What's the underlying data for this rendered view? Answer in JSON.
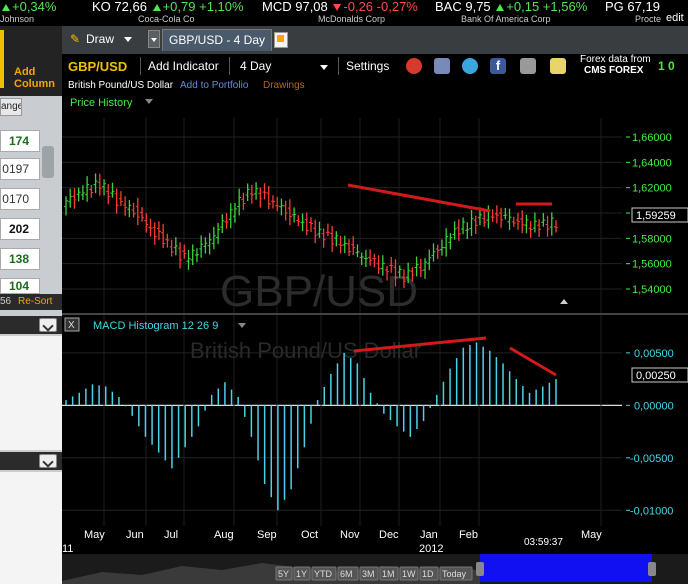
{
  "ticker": [
    {
      "symbol": "",
      "price": "",
      "change": "+0,34%",
      "direction": "up",
      "name": "Johnson"
    },
    {
      "symbol": "KO",
      "price": "72,66",
      "change": "+0,79",
      "pct": "+1,10%",
      "direction": "up",
      "name": "Coca-Cola Co"
    },
    {
      "symbol": "MCD",
      "price": "97,08",
      "change": "-0,26",
      "pct": "-0,27%",
      "direction": "down",
      "name": "McDonalds Corp"
    },
    {
      "symbol": "BAC",
      "price": "9,75",
      "change": "+0,15",
      "pct": "+1,56%",
      "direction": "up",
      "name": "Bank Of America Corp"
    },
    {
      "symbol": "PG",
      "price": "67,19",
      "change": "",
      "pct": "",
      "direction": "up",
      "name": "Procte"
    }
  ],
  "edit_label": "edit",
  "left_panel": {
    "add_column": [
      "Add",
      "Column"
    ],
    "change_header": "ange",
    "cells": [
      "174",
      "0197",
      "0170",
      "202",
      "138",
      "104"
    ],
    "small_left": "56",
    "resort": "Re-Sort"
  },
  "toolbar": {
    "draw_label": "Draw",
    "tab_label": "GBP/USD - 4 Day"
  },
  "chart_toolbar": {
    "symbol": "GBP/USD",
    "add_indicator": "Add Indicator",
    "period": "4 Day",
    "settings": "Settings",
    "forex_line1": "Forex data from",
    "forex_line2": "CMS FOREX",
    "right_label": "1 0"
  },
  "chart_header": {
    "description": "British Pound/US Dollar",
    "add_portfolio": "Add to Portfolio",
    "drawings": "Drawings",
    "price_history": "Price History"
  },
  "watermark": {
    "line1": "GBP/USD",
    "line2": "British Pound/US Dollar"
  },
  "macd": {
    "label": "MACD Histogram 12 26 9",
    "close_label": "X",
    "current": "0,00250"
  },
  "price_current": "1,59259",
  "clock": "03:59:37",
  "range_buttons": [
    "5Y",
    "1Y",
    "YTD",
    "6M",
    "3M",
    "1M",
    "1W",
    "1D",
    "Today"
  ],
  "colors": {
    "up_bar": "#38d438",
    "down_bar": "#ff3a3a",
    "macd_bar": "#4ad3e6",
    "trend_line": "#d21a1a",
    "axis_green": "#3ef03e",
    "axis_cyan": "#3fd8e8"
  },
  "chart_data": [
    {
      "type": "bar",
      "subtype": "ohlc",
      "series": [
        {
          "name": "Price History",
          "values": [
            1.608,
            1.617,
            1.623,
            1.61,
            1.602,
            1.588,
            1.576,
            1.564,
            1.572,
            1.586,
            1.605,
            1.618,
            1.611,
            1.602,
            1.592,
            1.584,
            1.578,
            1.57,
            1.562,
            1.556,
            1.55,
            1.558,
            1.572,
            1.586,
            1.592,
            1.598,
            1.596,
            1.591,
            1.59,
            1.5926
          ]
        }
      ],
      "y_axis": {
        "ticks": [
          1.54,
          1.56,
          1.58,
          1.6,
          1.62,
          1.64,
          1.66
        ],
        "tick_labels": [
          "1,54000",
          "1,56000",
          "1,58000",
          "1,60000",
          "1,62000",
          "1,64000",
          "1,66000"
        ],
        "ylim": [
          1.525,
          1.675
        ]
      },
      "x_axis": {
        "tick_labels": [
          "Jun",
          "Jul",
          "Aug",
          "Sep",
          "Oct",
          "Nov",
          "Dec",
          "Jan",
          "Feb",
          "May"
        ],
        "year_label": "2012",
        "left_label": "11"
      },
      "grid": true
    },
    {
      "type": "bar",
      "title": "MACD Histogram 12 26 9",
      "series": [
        {
          "name": "MACD Histogram 12 26 9",
          "values": [
            0.0005,
            0.0012,
            0.002,
            0.0018,
            0.0008,
            -0.001,
            -0.003,
            -0.0045,
            -0.006,
            -0.004,
            -0.002,
            0.001,
            0.0022,
            0.0008,
            -0.003,
            -0.0075,
            -0.01,
            -0.008,
            -0.004,
            0.0005,
            0.003,
            0.005,
            0.004,
            0.0012,
            -0.0008,
            -0.002,
            -0.003,
            -0.0015,
            0.001,
            0.0035,
            0.0055,
            0.006,
            0.0052,
            0.004,
            0.0025,
            0.0012,
            0.0018,
            0.0025
          ]
        }
      ],
      "y_axis": {
        "ticks": [
          -0.01,
          -0.005,
          0,
          0.005
        ],
        "tick_labels": [
          "-0,01000",
          "-0,00500",
          "0,00000",
          "0,00500"
        ],
        "ylim": [
          -0.0115,
          0.0068
        ]
      },
      "grid": true
    }
  ]
}
